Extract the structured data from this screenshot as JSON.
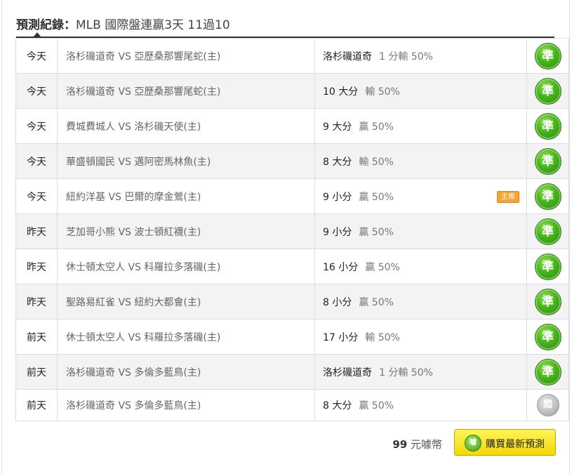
{
  "header": {
    "label": "預測紀錄：",
    "title": "MLB 國際盤連贏3天 11過10"
  },
  "rows": [
    {
      "day": "今天",
      "match": "洛杉磯道奇 VS 亞歷桑那響尾蛇(主)",
      "pick": "洛杉磯道奇",
      "odds": "1 分輸 50%",
      "badge": "",
      "result": "準"
    },
    {
      "day": "今天",
      "match": "洛杉磯道奇 VS 亞歷桑那響尾蛇(主)",
      "pick": "10 大分",
      "odds": "輸 50%",
      "badge": "",
      "result": "準"
    },
    {
      "day": "今天",
      "match": "費城費城人 VS 洛杉磯天使(主)",
      "pick": "9 大分",
      "odds": "贏 50%",
      "badge": "",
      "result": "準"
    },
    {
      "day": "今天",
      "match": "華盛頓國民 VS 邁阿密馬林魚(主)",
      "pick": "8 大分",
      "odds": "輸 50%",
      "badge": "",
      "result": "準"
    },
    {
      "day": "今天",
      "match": "紐約洋基 VS 巴爾的摩金鶯(主)",
      "pick": "9 小分",
      "odds": "贏 50%",
      "badge": "主推",
      "result": "準"
    },
    {
      "day": "昨天",
      "match": "芝加哥小熊 VS 波士頓紅襪(主)",
      "pick": "9 小分",
      "odds": "贏 50%",
      "badge": "",
      "result": "準"
    },
    {
      "day": "昨天",
      "match": "休士頓太空人 VS 科羅拉多落磯(主)",
      "pick": "16 小分",
      "odds": "贏 50%",
      "badge": "",
      "result": "準"
    },
    {
      "day": "昨天",
      "match": "聖路易紅雀 VS 紐約大都會(主)",
      "pick": "8 小分",
      "odds": "贏 50%",
      "badge": "",
      "result": "準"
    },
    {
      "day": "前天",
      "match": "休士頓太空人 VS 科羅拉多落磯(主)",
      "pick": "17 小分",
      "odds": "輸 50%",
      "badge": "",
      "result": "準"
    },
    {
      "day": "前天",
      "match": "洛杉磯道奇 VS 多倫多藍鳥(主)",
      "pick": "洛杉磯道奇",
      "odds": "1 分輸 50%",
      "badge": "",
      "result": "準"
    },
    {
      "day": "前天",
      "match": "洛杉磯道奇 VS 多倫多藍鳥(主)",
      "pick": "8 大分",
      "odds": "贏 50%",
      "badge": "",
      "result": "悶"
    }
  ],
  "purchase": {
    "price": "99",
    "unit": "元噱幣",
    "icon_text": "噱",
    "button_label": "購買最新預測"
  },
  "colors": {
    "hit": "#45b31a",
    "pending": "#bdbdbd",
    "badge": "#f5a331",
    "button": "#fbe326"
  }
}
